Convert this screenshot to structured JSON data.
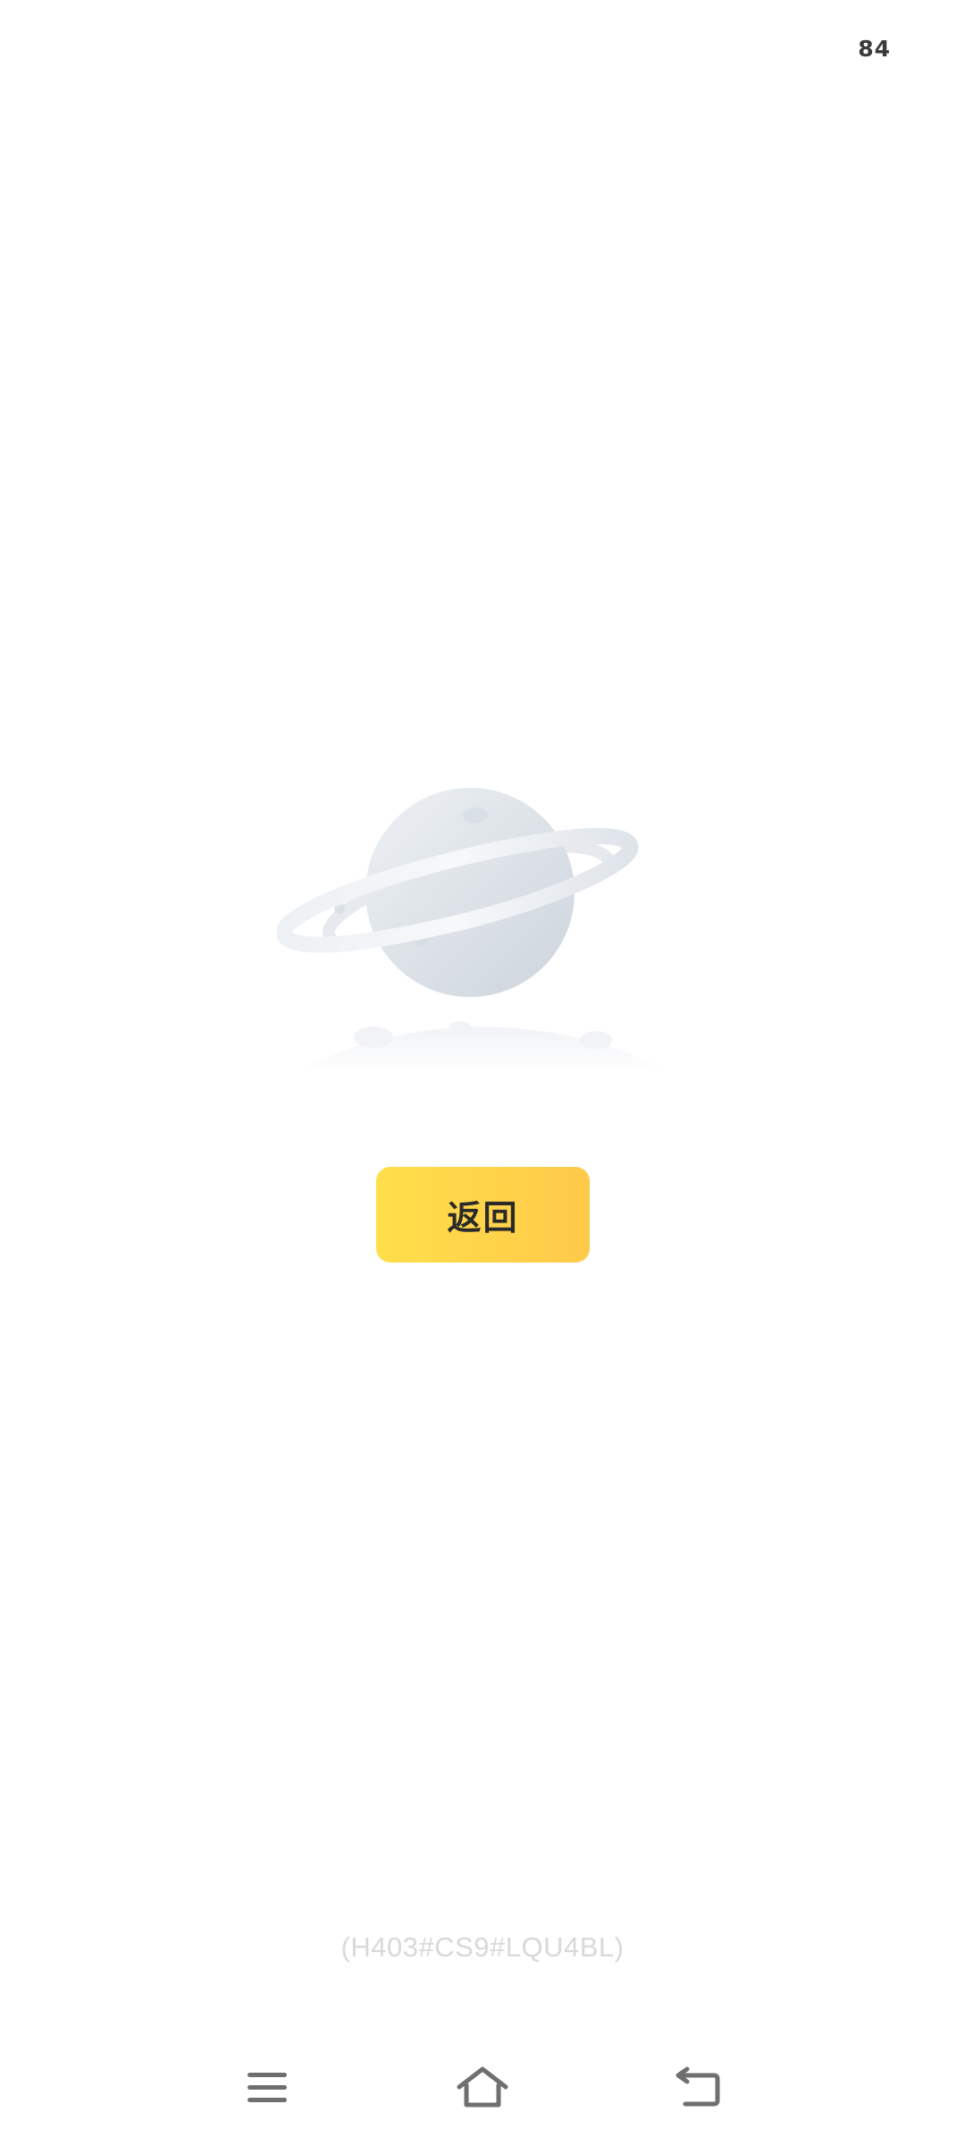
{
  "status_bar": {
    "battery_level": "84"
  },
  "illustration": {
    "icon": "planet-icon"
  },
  "actions": {
    "back_label": "返回"
  },
  "error": {
    "code": "(H403#CS9#LQU4BL)"
  },
  "nav_bar": {
    "menu_icon": "menu-icon",
    "home_icon": "home-icon",
    "back_icon": "back-icon"
  },
  "colors": {
    "button_gradient_start": "#ffdf4a",
    "button_gradient_end": "#ffc94a",
    "planet": "#dde2e8",
    "error_text": "#d9d9d9"
  }
}
